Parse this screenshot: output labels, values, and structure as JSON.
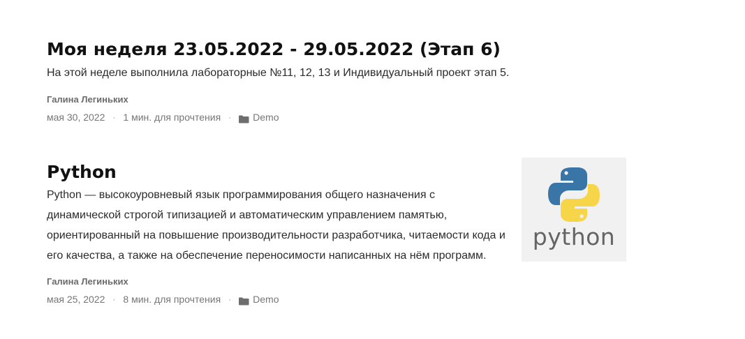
{
  "posts": [
    {
      "title": "Моя неделя 23.05.2022 - 29.05.2022 (Этап 6)",
      "summary": "На этой неделе выполнила лабораторные №11, 12, 13 и Индивидуальный проект этап 5.",
      "author": "Галина Легиньких",
      "date": "мая 30, 2022",
      "reading_time": "1 мин. для прочтения",
      "category": "Demo",
      "separator": "·"
    },
    {
      "title": "Python",
      "summary": "Python — высокоуровневый язык программирования общего назначения с динамической строгой типизацией и автоматическим управлением памятью, ориентированный на повышение производительности разработчика, читаемости кода и его качества, а также на обеспечение переносимости написанных на нём программ.",
      "author": "Галина Легиньких",
      "date": "мая 25, 2022",
      "reading_time": "8 мин. для прочтения",
      "category": "Demo",
      "separator": "·",
      "thumbnail": {
        "icon": "python-logo-icon",
        "label": "python",
        "colors": {
          "blue": "#3a75a8",
          "yellow": "#f7d548",
          "text": "#646464",
          "background": "#f1f1f1"
        }
      }
    }
  ],
  "colors": {
    "title": "#111111",
    "body_text": "#2b2b2b",
    "meta_text": "#767676",
    "author_text": "#6b6b6b"
  },
  "icons": {
    "category": "folder-icon"
  }
}
